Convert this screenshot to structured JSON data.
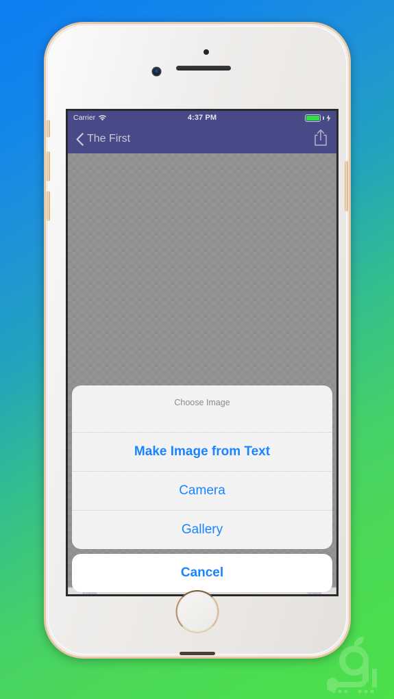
{
  "background": {
    "gradient_from": "#0d7df2",
    "gradient_to": "#4ce04a"
  },
  "watermark": {
    "name": "sibapp-logo-watermark",
    "color": "#b9f5b0"
  },
  "device": {
    "model_frame": "iphone-gold-white",
    "bezel_color": "#e8c8a4",
    "body_color": "#f0eeec"
  },
  "status_bar": {
    "carrier": "Carrier",
    "wifi_icon": "wifi-icon",
    "time": "4:37 PM",
    "battery_icon": "battery-full-icon",
    "battery_color": "#33dd44",
    "charging_icon": "lightning-bolt-icon"
  },
  "nav_bar": {
    "background": "#474a86",
    "back_icon": "chevron-left-icon",
    "back_label": "The First",
    "share_icon": "share-icon"
  },
  "content": {
    "placeholder": "transparent-checkerboard-canvas"
  },
  "hidden_toolbar": {
    "left_label": "Fonts",
    "right_label": "Share"
  },
  "action_sheet": {
    "title": "Choose Image",
    "actions": [
      {
        "label": "Make Image from Text",
        "strong": true
      },
      {
        "label": "Camera",
        "strong": false
      },
      {
        "label": "Gallery",
        "strong": false
      }
    ],
    "cancel_label": "Cancel",
    "tint_color": "#1a84ff",
    "title_color": "#8a8a8e"
  }
}
